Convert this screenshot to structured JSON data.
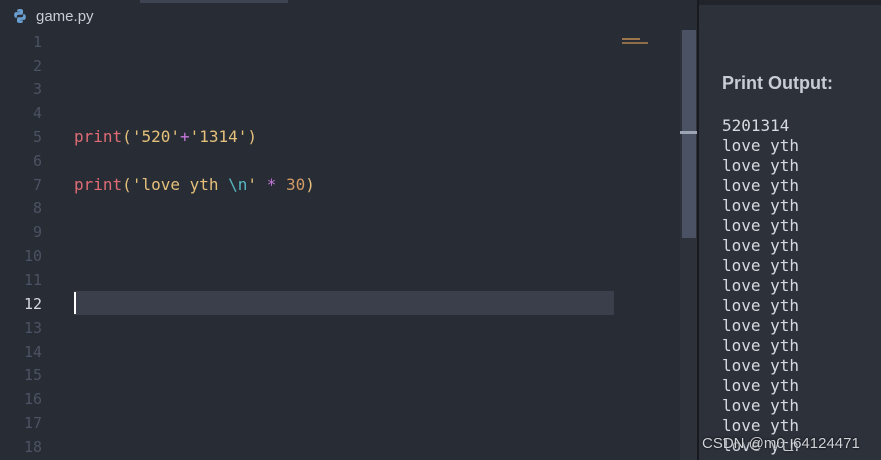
{
  "tab": {
    "filename": "game.py",
    "icon": "python-icon"
  },
  "editor": {
    "line_numbers": [
      "1",
      "2",
      "3",
      "4",
      "5",
      "6",
      "7",
      "8",
      "9",
      "10",
      "11",
      "12",
      "13",
      "14",
      "15",
      "16",
      "17",
      "18"
    ],
    "active_line": "12",
    "code": {
      "line5": {
        "fn": "print",
        "open": "(",
        "str1": "'520'",
        "plus": "+",
        "str2": "'1314'",
        "close": ")"
      },
      "line7": {
        "fn": "print",
        "open": "(",
        "str_a": "'love yth ",
        "esc": "\\n",
        "str_b": "'",
        "op": "*",
        "num": "30",
        "close": ")"
      }
    }
  },
  "output": {
    "title": "Print Output:",
    "lines": [
      "5201314",
      "love yth",
      "love yth",
      "love yth",
      "love yth",
      "love yth",
      "love yth",
      "love yth",
      "love yth",
      "love yth",
      "love yth",
      "love yth",
      "love yth",
      "love yth",
      "love yth",
      "love yth",
      "love yth"
    ]
  },
  "watermark": "CSDN @m0_64124471",
  "colors": {
    "editor_bg": "#282c34",
    "keyword": "#e06c75",
    "string": "#e5c07b",
    "escape": "#56b6c2",
    "operator": "#c678dd",
    "number": "#d19a66"
  }
}
